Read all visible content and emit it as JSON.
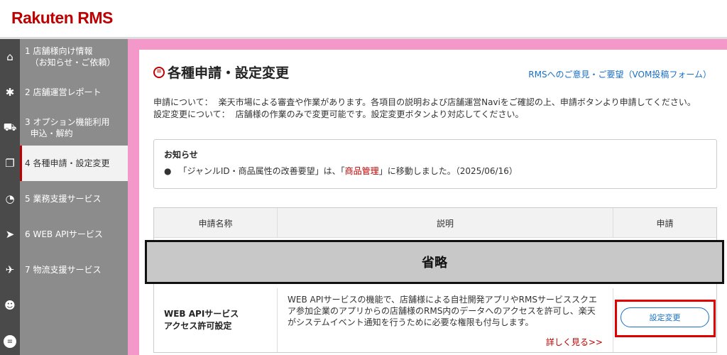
{
  "header": {
    "logo_text": "Rakuten",
    "logo_suffix": "RMS"
  },
  "sidebar": {
    "items": [
      {
        "num": "1",
        "label": "店舗様向け情報\n（お知らせ・ご依頼）",
        "icon": "home-icon",
        "glyph": "⌂"
      },
      {
        "num": "2",
        "label": "店舗運営レポート",
        "icon": "gear-icon",
        "glyph": "✱"
      },
      {
        "num": "3",
        "label": "オプション機能利用\n申込・解約",
        "icon": "cart-icon",
        "glyph": "⛟"
      },
      {
        "num": "4",
        "label": "各種申請・設定変更",
        "icon": "window-icon",
        "glyph": "❐",
        "active": true
      },
      {
        "num": "5",
        "label": "業務支援サービス",
        "icon": "pie-chart-icon",
        "glyph": "◔"
      },
      {
        "num": "6",
        "label": "WEB APIサービス",
        "icon": "paper-plane-icon",
        "glyph": "➤"
      },
      {
        "num": "7",
        "label": "物流支援サービス",
        "icon": "rocket-icon",
        "glyph": "✈"
      },
      {
        "num": "",
        "label": "",
        "icon": "users-icon",
        "glyph": "☻"
      }
    ]
  },
  "main": {
    "title": "各種申請・設定変更",
    "feedback_link": "RMSへのご意見・ご要望（VOM投稿フォーム）",
    "desc1_label": "申請について：",
    "desc1_text": "楽天市場による審査や作業があります。各項目の説明および店舗運営Naviをご確認の上、申請ボタンより申請してください。",
    "desc2_label": "設定変更について：",
    "desc2_text": "店舗様の作業のみで変更可能です。設定変更ボタンより対応してください。",
    "notice": {
      "title": "お知らせ",
      "item_pre": "「ジャンルID・商品属性の改善要望」は、「",
      "item_link": "商品管理",
      "item_post": "」に移動しました。（2025/06/16）"
    },
    "table": {
      "headers": [
        "申請名称",
        "説明",
        "申請"
      ],
      "omitted_label": "省略",
      "row": {
        "name_line1": "WEB APIサービス",
        "name_line2": "アクセス許可設定",
        "description": "WEB APIサービスの機能で、店舗様による自社開発アプリやRMSサービススクエア参加企業のアプリからの店舗様のRMS内のデータへのアクセスを許可し、楽天がシステムイベント通知を行うために必要な権限も付与します。",
        "more_link": "詳しく見る>>",
        "button_label": "設定変更"
      }
    }
  }
}
